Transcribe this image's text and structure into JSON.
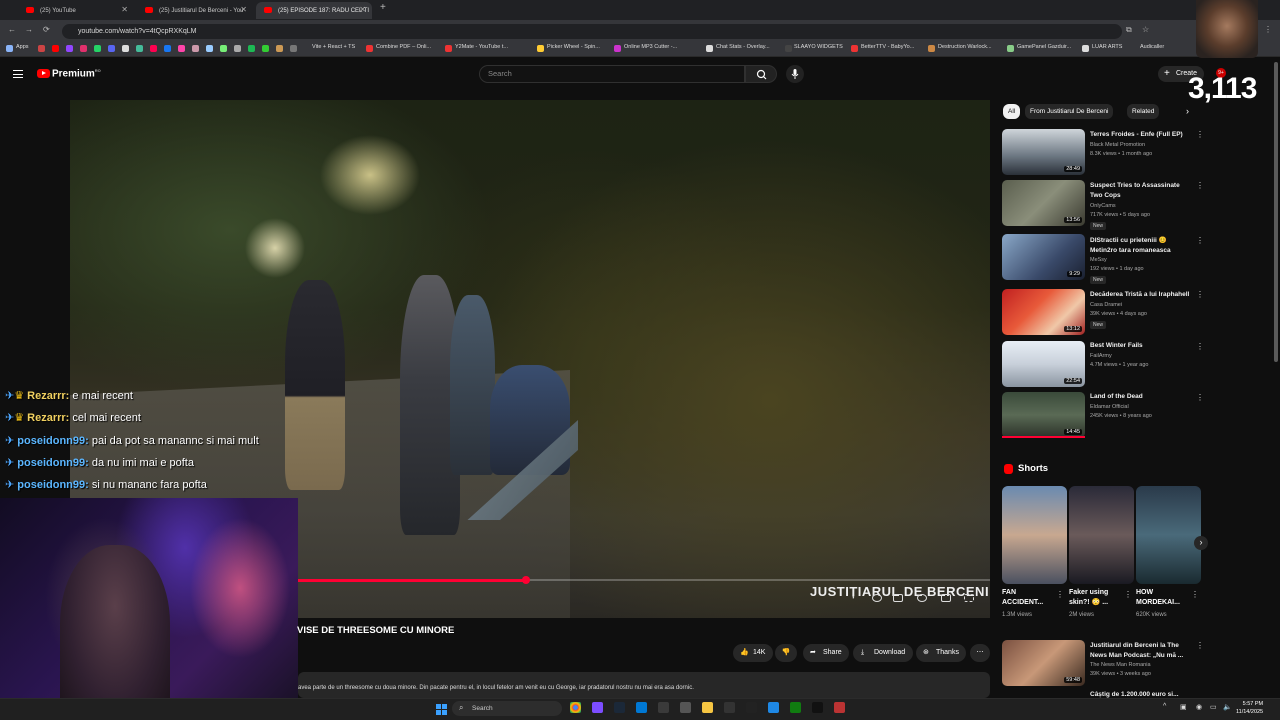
{
  "browser": {
    "tabs": [
      {
        "title": "(25) YouTube",
        "active": false
      },
      {
        "title": "(25) Justitiarul De Berceni - You",
        "active": false
      },
      {
        "title": "(25) EPISODE 187: RADU CEL TI",
        "active": true
      }
    ],
    "url": "youtube.com/watch?v=4tQcpRXKqLM",
    "bookmarks": [
      "Apps",
      "Vite + React + TS",
      "Combine PDF – Onli...",
      "Y2Mate - YouTube t...",
      "Picker Wheel - Spin...",
      "Online MP3 Cutter -...",
      "Chat Stats - Overlay...",
      "SLAAYO WIDGETS",
      "BetterTTV - BabyYo...",
      "Destruction Warlock...",
      "GamePanel Gazduir...",
      "LUAR ARTS",
      "Audicaller"
    ],
    "notification_badge": "9+"
  },
  "overlay": {
    "viewer_count": "3,113"
  },
  "youtube": {
    "brand": "Premium",
    "brand_superscript": "RO",
    "search_placeholder": "Search",
    "create_label": "Create"
  },
  "video": {
    "watermark": "JUSTIȚIARUL DE BERCENI",
    "progress": 0.33,
    "title": "VISE DE THREESOME CU MINORE",
    "like_count": "14K",
    "share_label": "Share",
    "download_label": "Download",
    "thanks_label": "Thanks",
    "description": "avea parte de un threesome cu doua minore. Din pacate pentru el, in locul fetelor am venit eu cu George, iar pradatorul nostru nu mai era asa dornic."
  },
  "chat": [
    {
      "user": "Rezarrr:",
      "message": "e mai recent",
      "vip": true
    },
    {
      "user": "Rezarrr:",
      "message": "cel mai recent",
      "vip": true
    },
    {
      "user": "poseidonn99:",
      "message": "pai da pot sa manannc si mai mult",
      "vip": false
    },
    {
      "user": "poseidonn99:",
      "message": "da nu imi mai e pofta",
      "vip": false
    },
    {
      "user": "poseidonn99:",
      "message": "si nu mananc fara pofta",
      "vip": false
    }
  ],
  "sidebar": {
    "chips": [
      "All",
      "From Justitiarul De Berceni",
      "Related"
    ],
    "recommendations": [
      {
        "title": "Terres Froides - Enfe (Full EP)",
        "channel": "Black Metal Promotion",
        "meta": "8.3K views • 1 month ago",
        "duration": "28:49",
        "new": false
      },
      {
        "title": "Suspect Tries to Assassinate Two Cops",
        "channel": "OnlyCams",
        "meta": "717K views • 5 days ago",
        "duration": "13:56",
        "new": true
      },
      {
        "title": "DIStractii cu prieteniii 😊 Metin2ro tara romaneasca",
        "channel": "MeSsy",
        "meta": "192 views • 1 day ago",
        "duration": "9:29",
        "new": true
      },
      {
        "title": "Decăderea Tristă a lui Iraphahell",
        "channel": "Casa Dramei",
        "meta": "39K views • 4 days ago",
        "duration": "13:12",
        "new": true
      },
      {
        "title": "Best Winter Fails",
        "channel": "FailArmy",
        "meta": "4.7M views • 1 year ago",
        "duration": "22:54",
        "new": false
      },
      {
        "title": "Land of the Dead",
        "channel": "Eldamar Official",
        "meta": "245K views • 8 years ago",
        "duration": "14:45",
        "new": false
      }
    ],
    "shorts_label": "Shorts",
    "shorts": [
      {
        "title": "FAN ACCIDENT...",
        "views": "1.3M views"
      },
      {
        "title": "Faker using skin?! 😳 ...",
        "views": "2M views"
      },
      {
        "title": "HOW MORDEKAI...",
        "views": "620K views"
      }
    ],
    "bottom_rec": {
      "title": "Justitiarul din Berceni la The News Man Podcast: „Nu mă ...",
      "channel": "The News Man Romania",
      "meta": "39K views • 3 weeks ago",
      "duration": "59:48"
    },
    "bottom_rec2_title": "Câștig de 1.200.000 euro si..."
  },
  "taskbar": {
    "search_placeholder": "Search",
    "time": "5:57 PM",
    "date": "11/14/2025"
  },
  "colors": {
    "accent": "#ff0033",
    "bg": "#0f0f0f"
  }
}
